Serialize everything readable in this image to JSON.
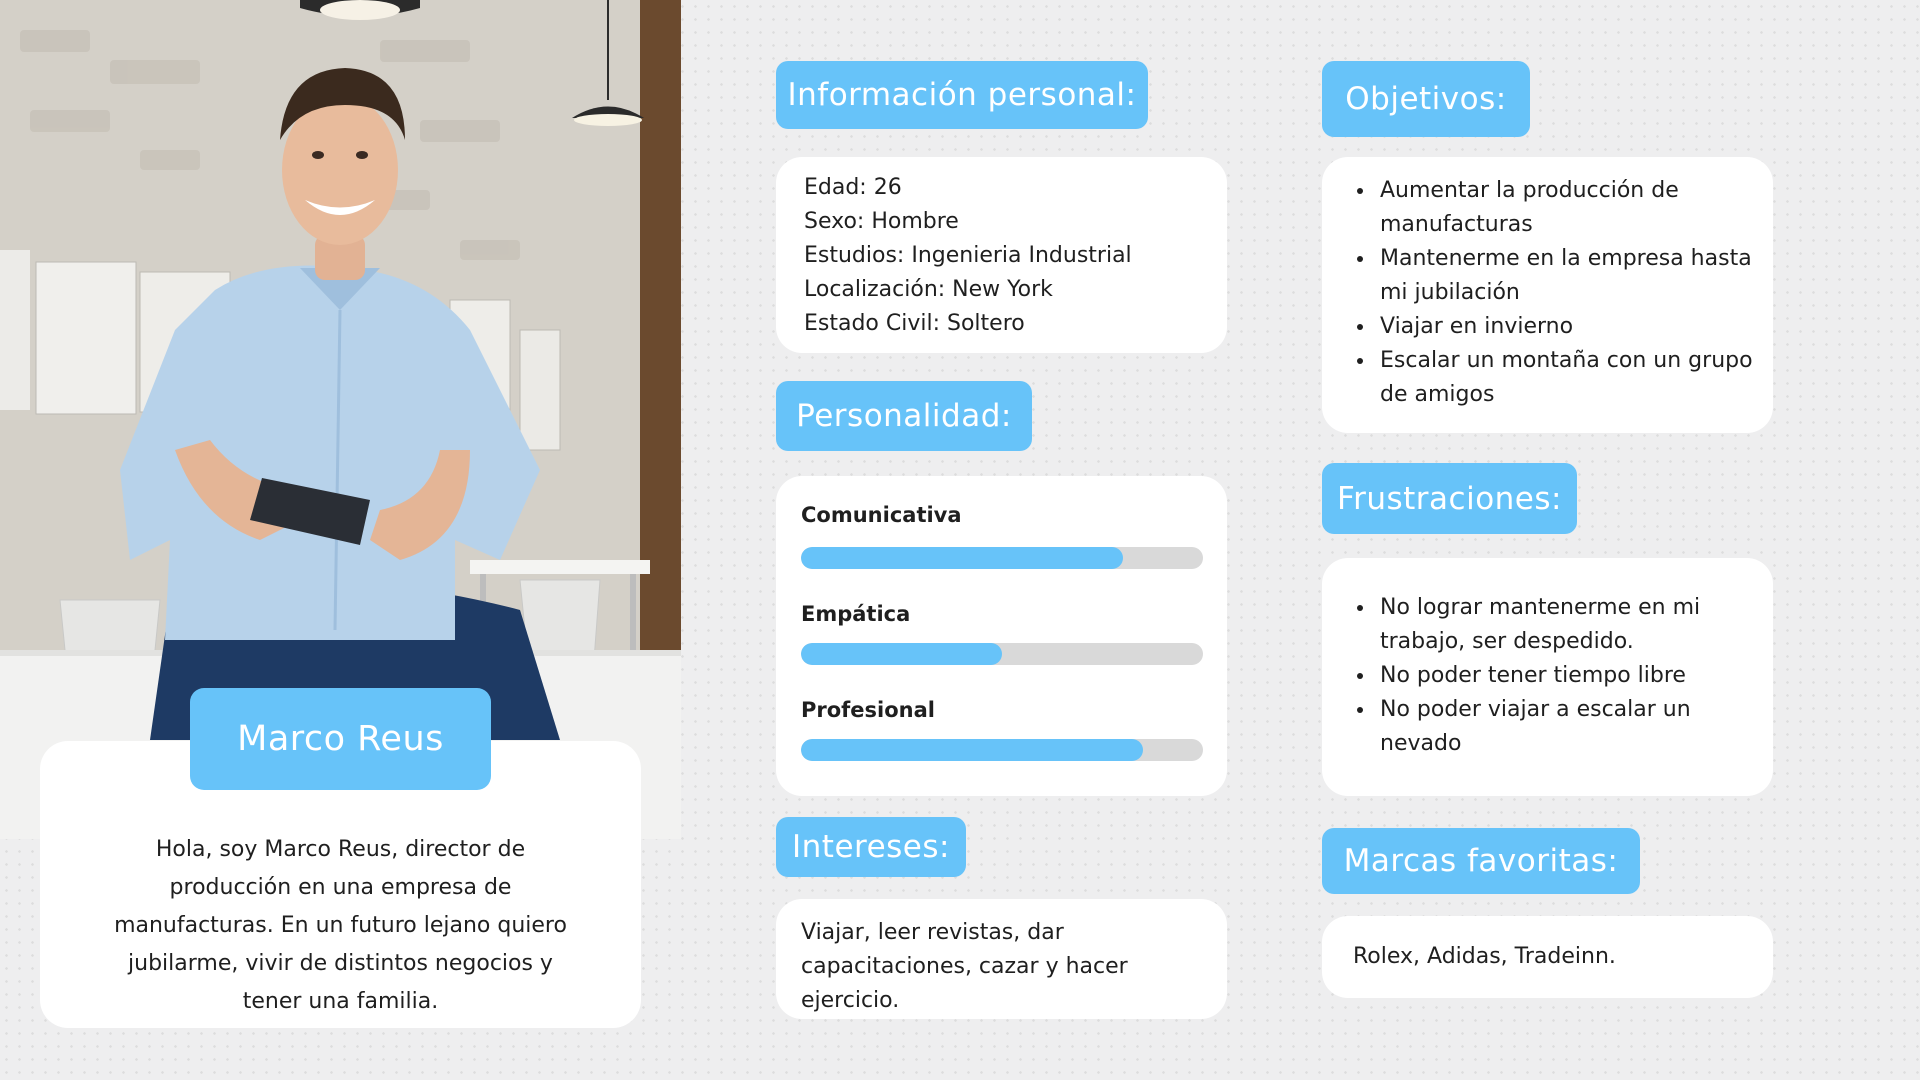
{
  "profile": {
    "name": "Marco Reus",
    "intro": "Hola, soy Marco Reus, director de producción en una empresa de manufacturas. En un futuro lejano quiero jubilarme, vivir de distintos negocios y tener una familia."
  },
  "personal": {
    "title": "Información personal:",
    "lines": [
      "Edad: 26",
      "Sexo: Hombre",
      "Estudios: Ingenieria Industrial",
      "Localización: New York",
      "Estado Civil: Soltero"
    ]
  },
  "personality": {
    "title": "Personalidad:",
    "traits": [
      {
        "label": "Comunicativa",
        "level": 0.8
      },
      {
        "label": "Empática",
        "level": 0.5
      },
      {
        "label": "Profesional",
        "level": 0.85
      }
    ]
  },
  "interests": {
    "title": "Intereses:",
    "lines": [
      "Viajar, leer revistas, dar",
      "capacitaciones, cazar y hacer",
      "ejercicio."
    ]
  },
  "goals": {
    "title": "Objetivos:",
    "items": [
      "Aumentar la producción de manufacturas",
      "Mantenerme en la empresa hasta mi jubilación",
      "Viajar en invierno",
      "Escalar un montaña con un grupo de amigos"
    ]
  },
  "frustrations": {
    "title": "Frustraciones:",
    "items": [
      "No lograr mantenerme en mi trabajo, ser despedido.",
      "No poder tener tiempo libre",
      "No poder viajar a escalar un nevado"
    ]
  },
  "brands": {
    "title": "Marcas favoritas:",
    "text": "Rolex, Adidas, Tradeinn."
  },
  "colors": {
    "accent": "#67c3f9",
    "card": "#ffffff",
    "bar_track": "#d9d9d9"
  }
}
